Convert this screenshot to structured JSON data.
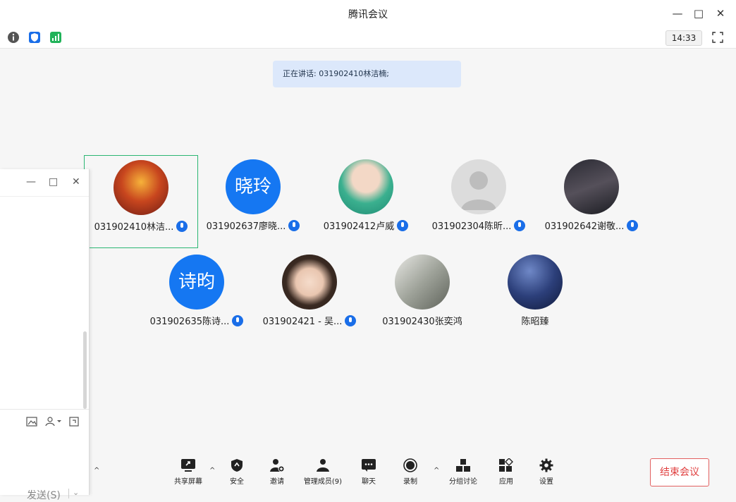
{
  "window": {
    "title": "腾讯会议"
  },
  "clock": "14:33",
  "speaking": "正在讲话: 031902410林洁楠;",
  "participants": [
    {
      "name": "031902410林洁...",
      "avatar_text": "",
      "mic": true
    },
    {
      "name": "031902637廖晓...",
      "avatar_text": "晓玲",
      "mic": true
    },
    {
      "name": "031902412卢威",
      "avatar_text": "",
      "mic": true
    },
    {
      "name": "031902304陈昕...",
      "avatar_text": "",
      "mic": true
    },
    {
      "name": "031902642谢敬...",
      "avatar_text": "",
      "mic": true
    },
    {
      "name": "031902635陈诗...",
      "avatar_text": "诗昀",
      "mic": true
    },
    {
      "name": "031902421 - 吴...",
      "avatar_text": "",
      "mic": true
    },
    {
      "name": "031902430张奕鸿",
      "avatar_text": "",
      "mic": false
    },
    {
      "name": "陈昭臻",
      "avatar_text": "",
      "mic": false
    }
  ],
  "side_panel": {
    "send_label": "发送(S)"
  },
  "toolbar": {
    "share": "共享屏幕",
    "security": "安全",
    "invite": "邀请",
    "manage": "管理成员(9)",
    "chat": "聊天",
    "record": "录制",
    "breakout": "分组讨论",
    "apps": "应用",
    "settings": "设置",
    "end": "结束会议"
  }
}
